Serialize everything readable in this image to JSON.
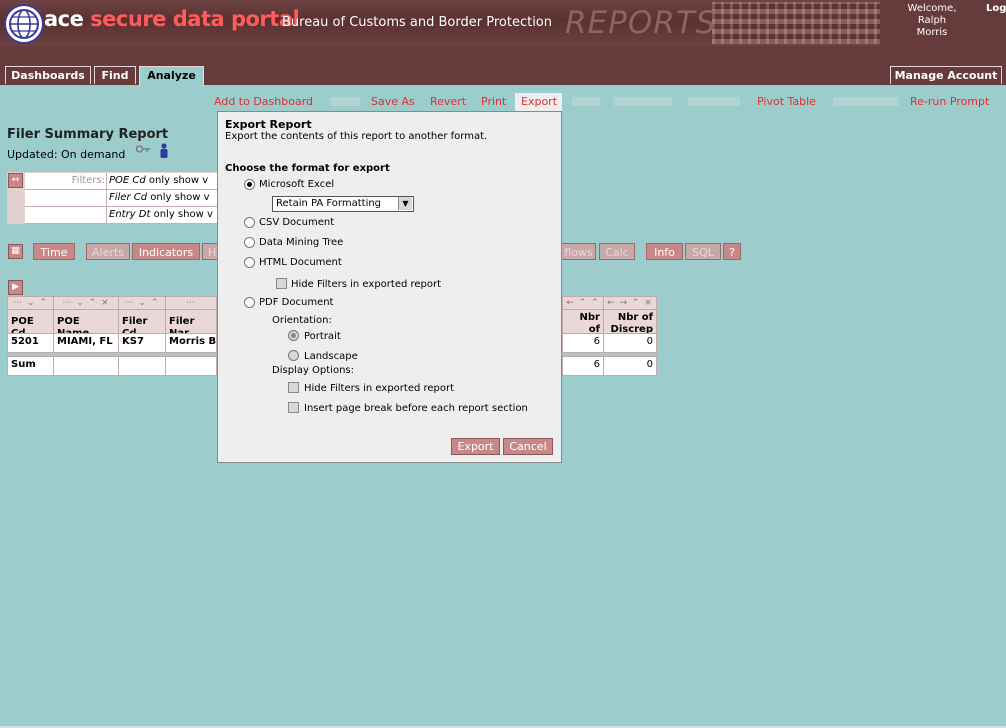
{
  "header": {
    "logo_prefix": "ace",
    "logo_rest": " secure data portal",
    "agency": "Bureau of Customs and Border Protection",
    "reports_word": "REPORTS",
    "welcome_label": "Welcome,",
    "user_first": "Ralph",
    "user_last": "Morris",
    "logout": "Log"
  },
  "nav": {
    "tabs": [
      {
        "label": "Dashboards"
      },
      {
        "label": "Find"
      },
      {
        "label": "Analyze"
      }
    ],
    "manage_account": "Manage Account"
  },
  "actions": {
    "add_to_dashboard": "Add to Dashboard",
    "save_as": "Save As",
    "revert": "Revert",
    "print": "Print",
    "export": "Export",
    "pivot_table": "Pivot Table",
    "rerun_prompt": "Re-run Prompt"
  },
  "report": {
    "title": "Filer Summary Report",
    "updated": "Updated: On demand"
  },
  "filters": {
    "label": "Filters:",
    "rows": [
      {
        "field": "POE Cd",
        "text": " only show v"
      },
      {
        "field": "Filer Cd",
        "text": " only show v"
      },
      {
        "field": "Entry Dt",
        "text": " only show v"
      }
    ]
  },
  "toolbar": {
    "time": "Time",
    "alerts": "Alerts",
    "indicators": "Indicators",
    "h": "H",
    "flows": "flows",
    "calc": "Calc",
    "info": "Info",
    "sql": "SQL",
    "help": "?"
  },
  "table": {
    "columns": [
      "POE Cd",
      "POE Name",
      "Filer Cd",
      "Filer Nar"
    ],
    "right_columns": [
      "Nbr of Lines",
      "Nbr of Discrep"
    ],
    "rows": [
      [
        "5201",
        "MIAMI, FL",
        "KS7",
        "Morris Br"
      ]
    ],
    "row_right": [
      "6",
      "0"
    ],
    "sum_label": "Sum",
    "sum_right": [
      "6",
      "0"
    ]
  },
  "dialog": {
    "title": "Export Report",
    "subtitle": "Export the contents of this report to another format.",
    "choose": "Choose the format for export",
    "excel": "Microsoft Excel",
    "excel_format": "Retain PA Formatting",
    "csv": "CSV Document",
    "dmt": "Data Mining Tree",
    "html": "HTML Document",
    "html_hide_filters": "Hide Filters in exported report",
    "pdf": "PDF Document",
    "orientation": "Orientation:",
    "portrait": "Portrait",
    "landscape": "Landscape",
    "display_options": "Display Options:",
    "pdf_hide_filters": "Hide Filters in exported report",
    "page_break": "Insert page break before each report section",
    "export_btn": "Export",
    "cancel_btn": "Cancel"
  },
  "colors": {
    "header_bg": "#663b3b",
    "page_bg": "#9ccccc",
    "accent_red": "#e03030",
    "button_bg": "#c88888"
  }
}
